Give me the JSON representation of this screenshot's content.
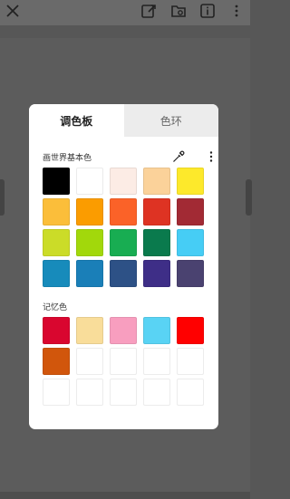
{
  "topbar": {
    "icons": [
      "close-icon",
      "edit-export-icon",
      "image-folder-icon",
      "info-icon",
      "more-vertical-icon"
    ]
  },
  "dialog": {
    "tabs": [
      {
        "label": "调色板",
        "active": true
      },
      {
        "label": "色环",
        "active": false
      }
    ],
    "palette": {
      "title": "画世界基本色",
      "colors": [
        "#000000",
        "#ffffff",
        "#fcece5",
        "#fbd29a",
        "#fde92b",
        "#fbbe3a",
        "#fb9c00",
        "#fb6228",
        "#de3323",
        "#a22a34",
        "#cbdc28",
        "#a2d80b",
        "#18ad52",
        "#0a7a4d",
        "#46cdf5",
        "#178bbb",
        "#1a7fb8",
        "#2d5186",
        "#3e2e87",
        "#4a4270"
      ]
    },
    "memory": {
      "title": "记忆色",
      "colors": [
        "#d9062f",
        "#f9dd9a",
        "#f89ebf",
        "#59d3f4",
        "#ff0000",
        "#d1560c",
        "",
        "",
        "",
        "",
        "",
        "",
        "",
        "",
        ""
      ]
    }
  }
}
